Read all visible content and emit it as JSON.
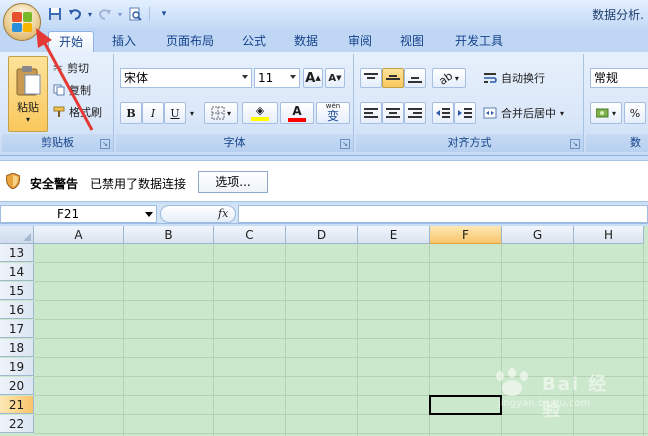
{
  "window": {
    "title": "数据分析.",
    "qat": [
      "save-icon",
      "undo-icon",
      "redo-icon",
      "print-preview-icon"
    ]
  },
  "tabs": [
    {
      "label": "开始",
      "active": true
    },
    {
      "label": "插入"
    },
    {
      "label": "页面布局"
    },
    {
      "label": "公式"
    },
    {
      "label": "数据"
    },
    {
      "label": "审阅"
    },
    {
      "label": "视图"
    },
    {
      "label": "开发工具"
    }
  ],
  "clipboard": {
    "paste": "粘贴",
    "cut": "剪切",
    "copy": "复制",
    "format_painter": "格式刷",
    "label": "剪贴板"
  },
  "font": {
    "name": "宋体",
    "size": "11",
    "grow": "A",
    "shrink": "A",
    "bold": "B",
    "italic": "I",
    "underline": "U",
    "font_color_glyph": "A",
    "phonetic": "变",
    "phonetic_small": "wén",
    "label": "字体",
    "highlight_color": "#ffff00",
    "font_color": "#ff0000"
  },
  "alignment": {
    "wrap_text": "自动换行",
    "merge_center": "合并后居中",
    "label": "对齐方式"
  },
  "number": {
    "format": "常规",
    "percent": "%",
    "label": "数"
  },
  "security": {
    "title": "安全警告",
    "message": "已禁用了数据连接",
    "options": "选项..."
  },
  "formula_bar": {
    "name_box": "F21",
    "fx": "fx"
  },
  "grid": {
    "columns": [
      "A",
      "B",
      "C",
      "D",
      "E",
      "F",
      "G",
      "H"
    ],
    "rows": [
      "13",
      "14",
      "15",
      "16",
      "17",
      "18",
      "19",
      "20",
      "21",
      "22"
    ],
    "selected_column": "F",
    "selected_row": "21"
  },
  "watermark": {
    "brand": "Bai 经验",
    "url": "jingyan.baidu.com"
  },
  "colors": {
    "accent": "#15428b",
    "ribbon": "#dbe8f9",
    "grid_bg": "#cce8cc",
    "annotation": "#e53935"
  }
}
